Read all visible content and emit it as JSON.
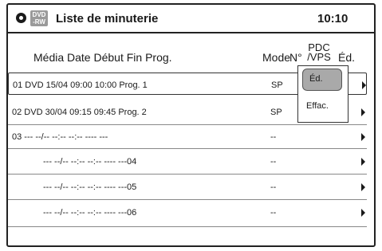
{
  "header": {
    "badge_line1": "DVD",
    "badge_line2": "-RW",
    "title": "Liste de minuterie",
    "clock": "10:10"
  },
  "columns": {
    "media_date_etc": "Média Date Début Fin Prog.",
    "mode": "Mode",
    "n": "N°",
    "pdc_line1": "PDC",
    "pdc_line2": "/VPS",
    "ed": "Éd."
  },
  "rows": [
    {
      "text": "01 DVD  15/04 09:00 10:00 Prog. 1",
      "mode": "SP",
      "indent": false
    },
    {
      "text": "02 DVD  30/04 09:15 09:45 Prog. 2",
      "mode": "SP",
      "indent": false
    },
    {
      "text": "03 --- --/-- --:-- --:-- ---- ---",
      "mode": "--",
      "indent": false
    },
    {
      "text": "--- --/-- --:-- --:-- ---- ---04",
      "mode": "--",
      "indent": true
    },
    {
      "text": "--- --/-- --:-- --:-- ---- ---05",
      "mode": "--",
      "indent": true
    },
    {
      "text": "--- --/-- --:-- --:-- ---- ---06",
      "mode": "--",
      "indent": true
    }
  ],
  "popup": {
    "edit": "Éd.",
    "delete": "Effac."
  }
}
